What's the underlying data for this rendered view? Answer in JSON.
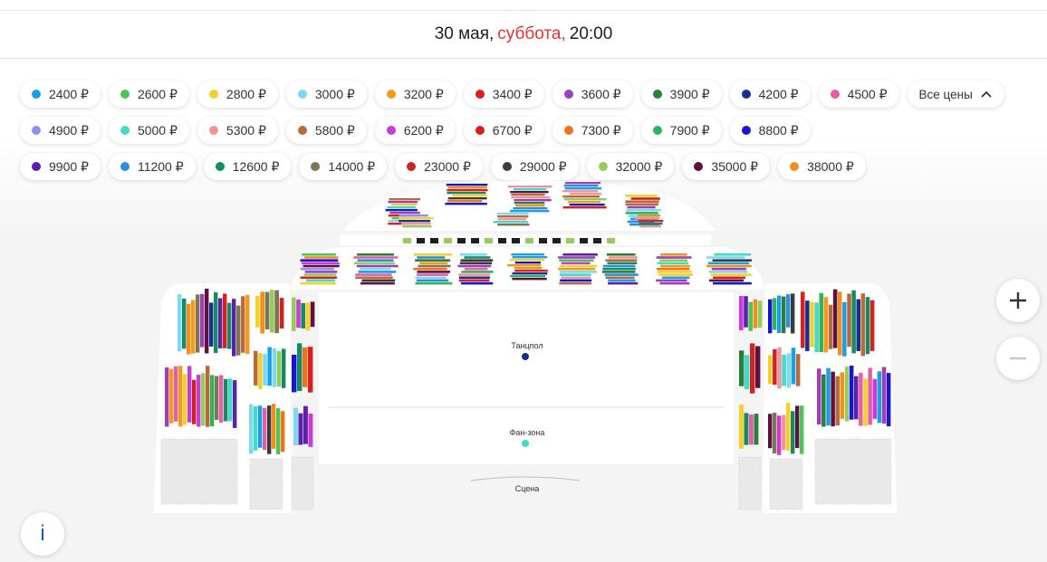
{
  "header": {
    "date": "30 мая,",
    "weekday": "суббота,",
    "time": "20:00"
  },
  "price_filters": {
    "row1": [
      {
        "label": "2400 ₽",
        "color": "#1d9ee4"
      },
      {
        "label": "2600 ₽",
        "color": "#4cc45a"
      },
      {
        "label": "2800 ₽",
        "color": "#f5cf2b"
      },
      {
        "label": "3000 ₽",
        "color": "#7dd8f2"
      },
      {
        "label": "3200 ₽",
        "color": "#f39a1d"
      },
      {
        "label": "3400 ₽",
        "color": "#d9201f"
      },
      {
        "label": "3600 ₽",
        "color": "#9e3fb8"
      },
      {
        "label": "3900 ₽",
        "color": "#2a7f3a"
      },
      {
        "label": "4200 ₽",
        "color": "#17308f"
      },
      {
        "label": "4500 ₽",
        "color": "#e260a8"
      }
    ],
    "all_prices_label": "Все цены",
    "row2": [
      {
        "label": "4900 ₽",
        "color": "#8e8fe6"
      },
      {
        "label": "5000 ₽",
        "color": "#43d9c9"
      },
      {
        "label": "5300 ₽",
        "color": "#f49494"
      },
      {
        "label": "5800 ₽",
        "color": "#b86a3d"
      },
      {
        "label": "6200 ₽",
        "color": "#c93ad9"
      },
      {
        "label": "6700 ₽",
        "color": "#d9201f"
      },
      {
        "label": "7300 ₽",
        "color": "#f2721c"
      },
      {
        "label": "7900 ₽",
        "color": "#2fb35a"
      },
      {
        "label": "8800 ₽",
        "color": "#1616cf"
      }
    ],
    "row3": [
      {
        "label": "9900 ₽",
        "color": "#5a22a8"
      },
      {
        "label": "11200 ₽",
        "color": "#2b8fd9"
      },
      {
        "label": "12600 ₽",
        "color": "#168a63"
      },
      {
        "label": "14000 ₽",
        "color": "#7d7553"
      },
      {
        "label": "23000 ₽",
        "color": "#cc2424"
      },
      {
        "label": "29000 ₽",
        "color": "#3b3b3b"
      },
      {
        "label": "32000 ₽",
        "color": "#95cd5c"
      },
      {
        "label": "35000 ₽",
        "color": "#5c123f"
      },
      {
        "label": "38000 ₽",
        "color": "#f0901c"
      }
    ]
  },
  "map": {
    "dance_floor_label": "Танцпол",
    "fan_zone_label": "Фан-зона",
    "stage_label": "Сцена",
    "dance_floor_color": "#17308f",
    "fan_zone_color": "#43d9c9"
  },
  "controls": {
    "zoom_in": "+",
    "zoom_out": "−",
    "info": "i"
  }
}
